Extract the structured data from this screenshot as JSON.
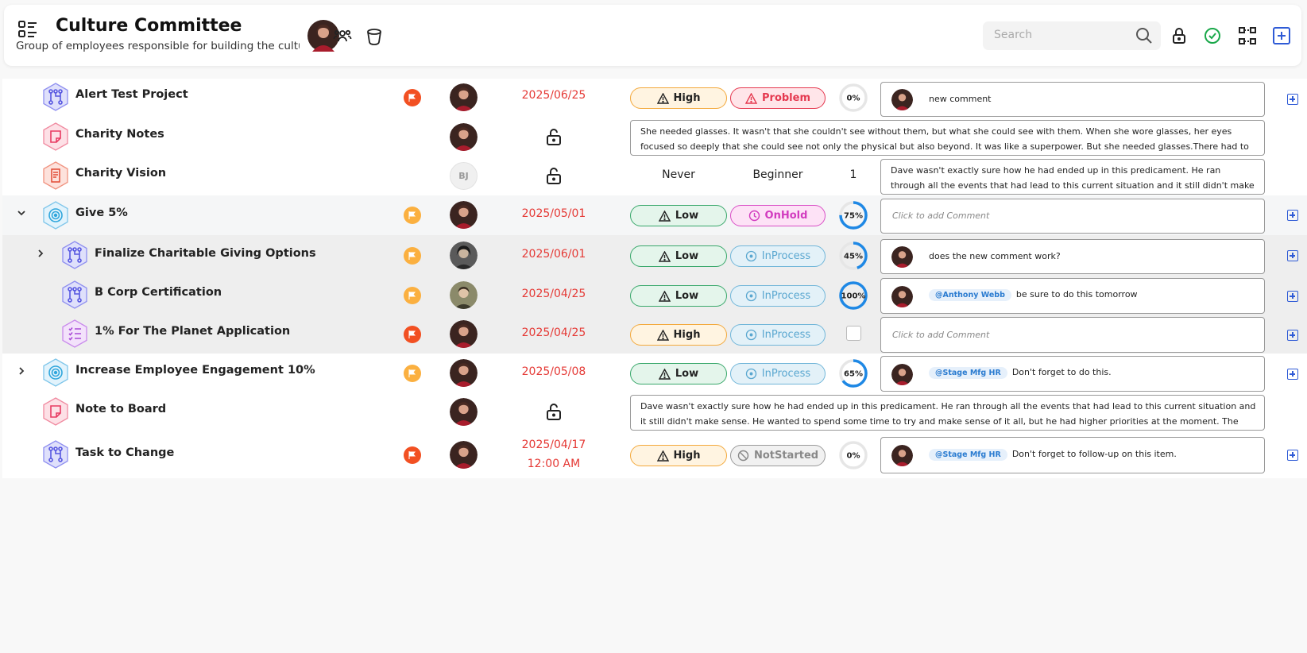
{
  "header": {
    "title": "Culture Committee",
    "subtitle": "Group of employees responsible for building the culture",
    "search_placeholder": "Search"
  },
  "rows": [
    {
      "name": "Alert Test Project",
      "icon": "project-icon",
      "flag": "red",
      "date": "2025/06/25",
      "priority": "High",
      "status": "Problem",
      "progress": "0%",
      "comment": "new comment"
    },
    {
      "name": "Charity Notes",
      "icon": "note-icon",
      "comment": "She needed glasses. It wasn't that she couldn't see without them, but what she could see with them. When she wore glasses, her eyes focused so deeply that she could see not only the physical but also beyond. It was like a superpower. But she needed glasses.There had to be a better way. That's all Nancy could..."
    },
    {
      "name": "Charity Vision",
      "icon": "document-icon",
      "avatar_initials": "BJ",
      "frequency": "Never",
      "level": "Beginner",
      "count": "1",
      "comment": "Dave wasn't exactly sure how he had ended up in this predicament. He ran through all the events that had lead to this current situation and it still didn't make sense. He wanted to..."
    },
    {
      "name": "Give 5%",
      "icon": "goal-icon",
      "flag": "orange",
      "date": "2025/05/01",
      "priority": "Low",
      "status": "OnHold",
      "progress": "75%",
      "comment_placeholder": "Click to add Comment"
    },
    {
      "name": "Finalize Charitable Giving Options",
      "icon": "project-icon",
      "flag": "orange",
      "date": "2025/06/01",
      "priority": "Low",
      "status": "InProcess",
      "progress": "45%",
      "comment": "does the new comment work?"
    },
    {
      "name": "B Corp Certification",
      "icon": "project-icon",
      "flag": "orange",
      "date": "2025/04/25",
      "priority": "Low",
      "status": "InProcess",
      "progress": "100%",
      "mention": "@Anthony Webb",
      "comment": "be sure to do this tomorrow"
    },
    {
      "name": "1% For The Planet Application",
      "icon": "checklist-icon",
      "flag": "red",
      "date": "2025/04/25",
      "priority": "High",
      "status": "InProcess",
      "comment_placeholder": "Click to add Comment"
    },
    {
      "name": "Increase Employee Engagement 10%",
      "icon": "goal-icon",
      "flag": "orange",
      "date": "2025/05/08",
      "priority": "Low",
      "status": "InProcess",
      "progress": "65%",
      "mention": "@Stage Mfg HR",
      "comment": "Don't forget to do this."
    },
    {
      "name": "Note to Board",
      "icon": "note-icon",
      "comment": "Dave wasn't exactly sure how he had ended up in this predicament. He ran through all the events that had lead to this current situation and it still didn't make sense. He wanted to spend some time to try and make sense of it all, but he had higher priorities at the moment. The first was how to get out of his current..."
    },
    {
      "name": "Task to Change",
      "icon": "project-icon",
      "flag": "red",
      "date": "2025/04/17",
      "time": "12:00 AM",
      "priority": "High",
      "status": "NotStarted",
      "progress": "0%",
      "mention": "@Stage Mfg HR",
      "comment": "Don't forget to follow-up on this item."
    }
  ],
  "progress_values": [
    0,
    75,
    45,
    100,
    65,
    0
  ],
  "colors": {
    "accent": "#2f5bd6",
    "date": "#e53935",
    "progress": "#1e88e5"
  }
}
